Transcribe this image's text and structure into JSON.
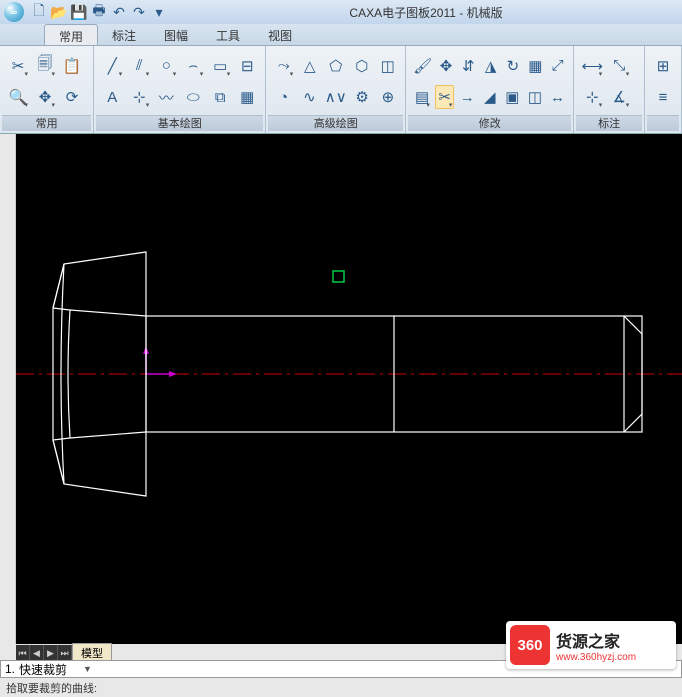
{
  "title": "CAXA电子图板2011 - 机械版",
  "tabs": {
    "t0": "常用",
    "t1": "标注",
    "t2": "图幅",
    "t3": "工具",
    "t4": "视图"
  },
  "panels": {
    "p0": "常用",
    "p1": "基本绘图",
    "p2": "高级绘图",
    "p3": "修改",
    "p4": "标注"
  },
  "model_tab": "模型",
  "cmd_prefix": "1.",
  "cmd_value": "快速裁剪",
  "status": "拾取要裁剪的曲线:",
  "wm": {
    "badge": "360",
    "cn": "货源之家",
    "url": "www.360hyzj.com"
  }
}
